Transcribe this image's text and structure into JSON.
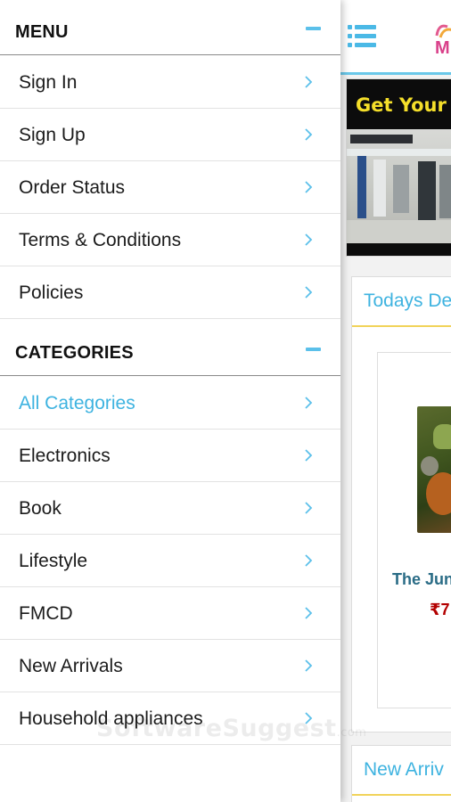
{
  "drawer": {
    "menu": {
      "title": "MENU",
      "items": [
        {
          "label": "Sign In"
        },
        {
          "label": "Sign Up"
        },
        {
          "label": "Order Status"
        },
        {
          "label": "Terms & Conditions"
        },
        {
          "label": "Policies"
        }
      ]
    },
    "categories": {
      "title": "CATEGORIES",
      "items": [
        {
          "label": "All Categories",
          "active": true
        },
        {
          "label": "Electronics"
        },
        {
          "label": "Book"
        },
        {
          "label": "Lifestyle"
        },
        {
          "label": "FMCD"
        },
        {
          "label": "New Arrivals"
        },
        {
          "label": "Household appliances"
        }
      ]
    },
    "icons": {
      "collapse": "minus-icon",
      "item": "chevron-right-icon"
    },
    "accent_color": "#3eb3e0"
  },
  "app": {
    "header": {
      "menu_icon": "list-menu-icon",
      "logo": "store-logo"
    },
    "banner": {
      "text": "Get Your E"
    },
    "todays_deals": {
      "title": "Todays De",
      "product": {
        "name": "The Jun",
        "price": "₹7"
      }
    },
    "new_arrivals": {
      "title": "New Arriv"
    }
  },
  "watermark": {
    "text": "SoftwareSuggest",
    "suffix": ".com"
  }
}
